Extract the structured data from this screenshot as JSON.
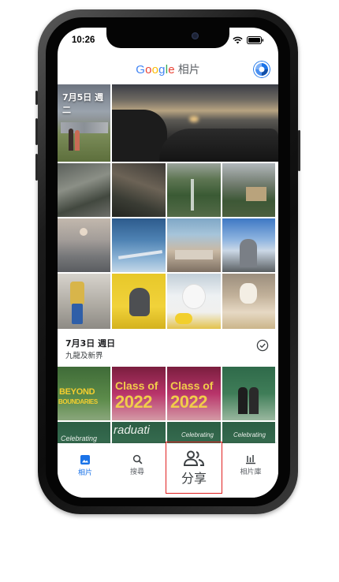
{
  "status_bar": {
    "time": "10:26"
  },
  "header": {
    "logo_letters": [
      "G",
      "o",
      "o",
      "g",
      "l",
      "e"
    ],
    "logo_suffix": "相片"
  },
  "sections": [
    {
      "date_label": "7月5日 週二"
    },
    {
      "date_label": "7月3日 週日",
      "location": "九龍及新界"
    }
  ],
  "posters": {
    "beyond_line1": "BEYOND",
    "beyond_line2": "BOUNDARIES",
    "class_of": "Class of",
    "class_year": "2022",
    "class_of_2": "Class of",
    "class_year_2": "2022",
    "celebrating": "Celebrating",
    "graduation": "raduati",
    "celebrating_2": "Celebrating",
    "celebrating_3": "Celebrating"
  },
  "bottom_nav": {
    "items": [
      {
        "label": "相片",
        "icon": "photo-icon",
        "active": true
      },
      {
        "label": "搜尋",
        "icon": "search-icon",
        "active": false
      },
      {
        "label": "分享",
        "icon": "people-icon",
        "active": false
      },
      {
        "label": "相片庫",
        "icon": "library-icon",
        "active": false
      }
    ]
  },
  "colors": {
    "accent": "#1a73e8",
    "highlight_border": "#e02020"
  }
}
